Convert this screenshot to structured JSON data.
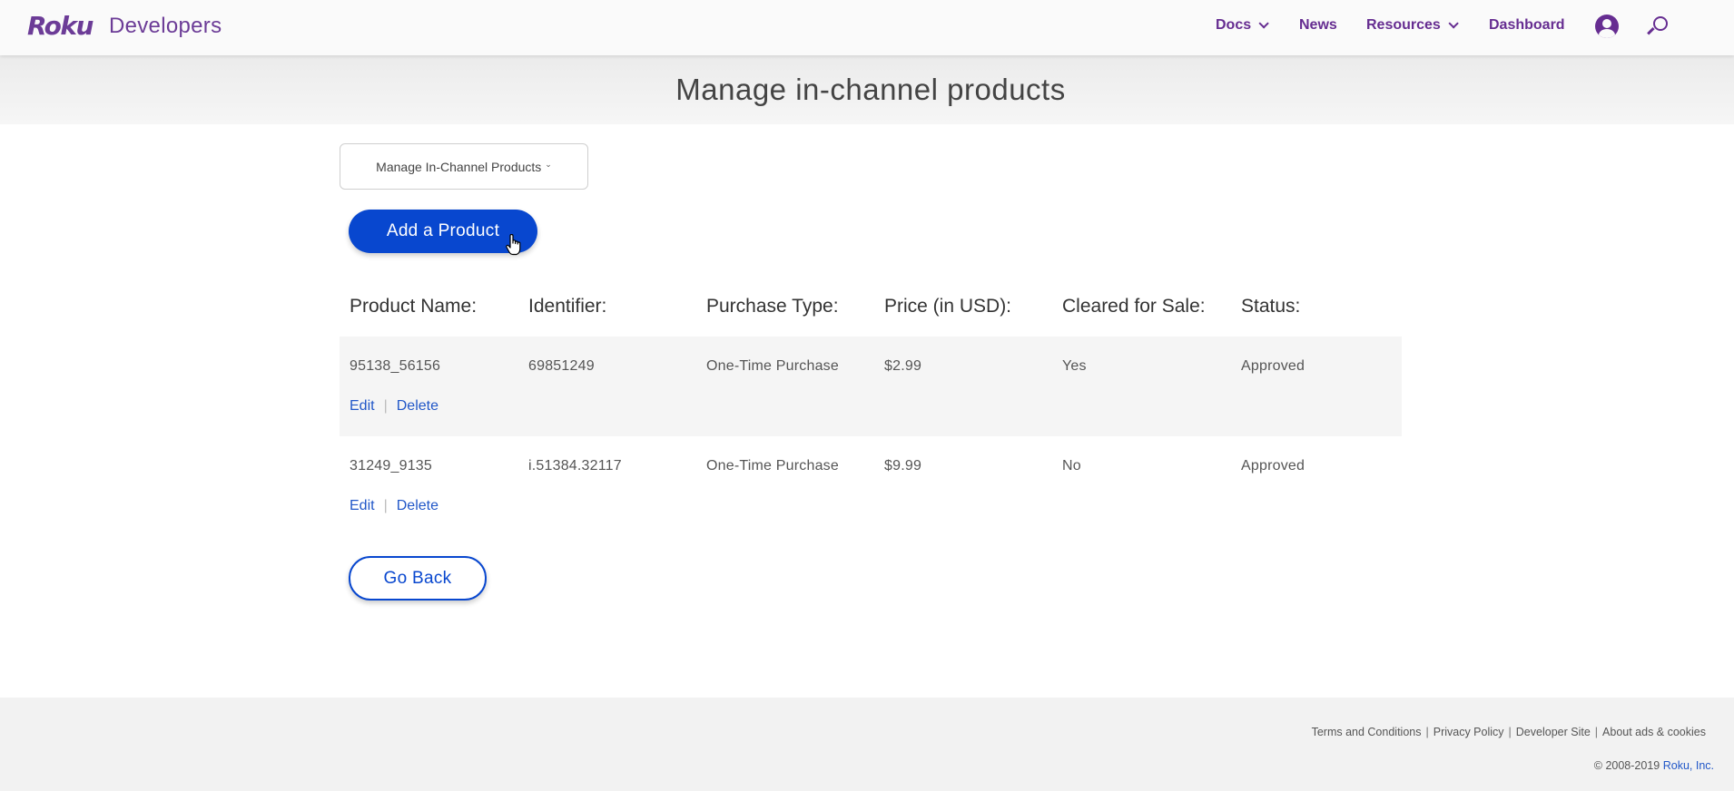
{
  "header": {
    "logo": "Roku",
    "site_name": "Developers",
    "nav": {
      "docs": "Docs",
      "news": "News",
      "resources": "Resources",
      "dashboard": "Dashboard"
    },
    "icons": [
      "user-icon",
      "search-icon"
    ]
  },
  "page": {
    "title": "Manage in-channel products",
    "selector_value": "Manage In-Channel Products",
    "add_button": "Add a Product",
    "back_button": "Go Back"
  },
  "table": {
    "headers": {
      "name": "Product Name:",
      "identifier": "Identifier:",
      "purchase_type": "Purchase Type:",
      "price": "Price (in USD):",
      "cleared": "Cleared for Sale:",
      "status": "Status:"
    },
    "rows": [
      {
        "name": "95138_56156",
        "identifier": "69851249",
        "purchase_type": "One-Time Purchase",
        "price": "$2.99",
        "cleared": "Yes",
        "status": "Approved",
        "edit": "Edit",
        "delete": "Delete"
      },
      {
        "name": "31249_9135",
        "identifier": "i.51384.32117",
        "purchase_type": "One-Time Purchase",
        "price": "$9.99",
        "cleared": "No",
        "status": "Approved",
        "edit": "Edit",
        "delete": "Delete"
      }
    ],
    "separator": "|"
  },
  "footer": {
    "links": {
      "terms": "Terms and Conditions",
      "privacy": "Privacy Policy",
      "developer_site": "Developer Site",
      "ads": "About ads & cookies"
    },
    "separator": "|",
    "copyright": "© 2008-2019",
    "company": "Roku, Inc."
  },
  "colors": {
    "brand_purple": "#662d91",
    "primary_blue": "#0847cf",
    "link_blue": "#2157c8"
  }
}
